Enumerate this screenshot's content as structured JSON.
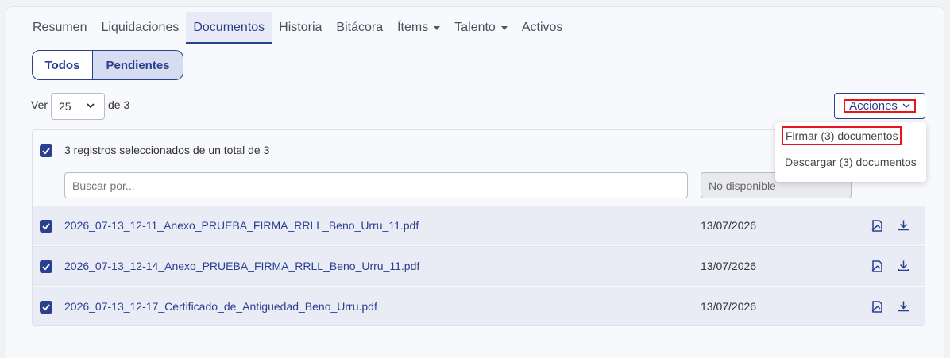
{
  "tabs": [
    {
      "label": "Resumen",
      "active": false,
      "dropdown": false
    },
    {
      "label": "Liquidaciones",
      "active": false,
      "dropdown": false
    },
    {
      "label": "Documentos",
      "active": true,
      "dropdown": false
    },
    {
      "label": "Historia",
      "active": false,
      "dropdown": false
    },
    {
      "label": "Bitácora",
      "active": false,
      "dropdown": false
    },
    {
      "label": "Ítems",
      "active": false,
      "dropdown": true
    },
    {
      "label": "Talento",
      "active": false,
      "dropdown": true
    },
    {
      "label": "Activos",
      "active": false,
      "dropdown": false
    }
  ],
  "filter": {
    "all_label": "Todos",
    "pending_label": "Pendientes",
    "selected": "Pendientes"
  },
  "pagination": {
    "ver_label": "Ver",
    "page_size": "25",
    "of_label": "de 3"
  },
  "actions": {
    "button_label": "Acciones",
    "menu": [
      {
        "label": "Firmar (3) documentos",
        "highlighted": true
      },
      {
        "label": "Descargar (3) documentos",
        "highlighted": false
      }
    ]
  },
  "selection": {
    "summary": "3 registros seleccionados de un total de 3"
  },
  "search": {
    "placeholder": "Buscar por...",
    "date_filter": "No disponible"
  },
  "documents": [
    {
      "name": "2026_07-13_12-11_Anexo_PRUEBA_FIRMA_RRLL_Beno_Urru_11.pdf",
      "date": "13/07/2026",
      "checked": true
    },
    {
      "name": "2026_07-13_12-14_Anexo_PRUEBA_FIRMA_RRLL_Beno_Urru_11.pdf",
      "date": "13/07/2026",
      "checked": true
    },
    {
      "name": "2026_07-13_12-17_Certificado_de_Antiguedad_Beno_Urru.pdf",
      "date": "13/07/2026",
      "checked": true
    }
  ],
  "colors": {
    "primary": "#2a3f8f",
    "highlight": "#e8151e",
    "row_bg": "#e9ecf5"
  },
  "icons": {
    "checkbox": "check-icon",
    "sign": "sign-document-icon",
    "download": "download-icon",
    "chevron": "chevron-down-icon"
  }
}
